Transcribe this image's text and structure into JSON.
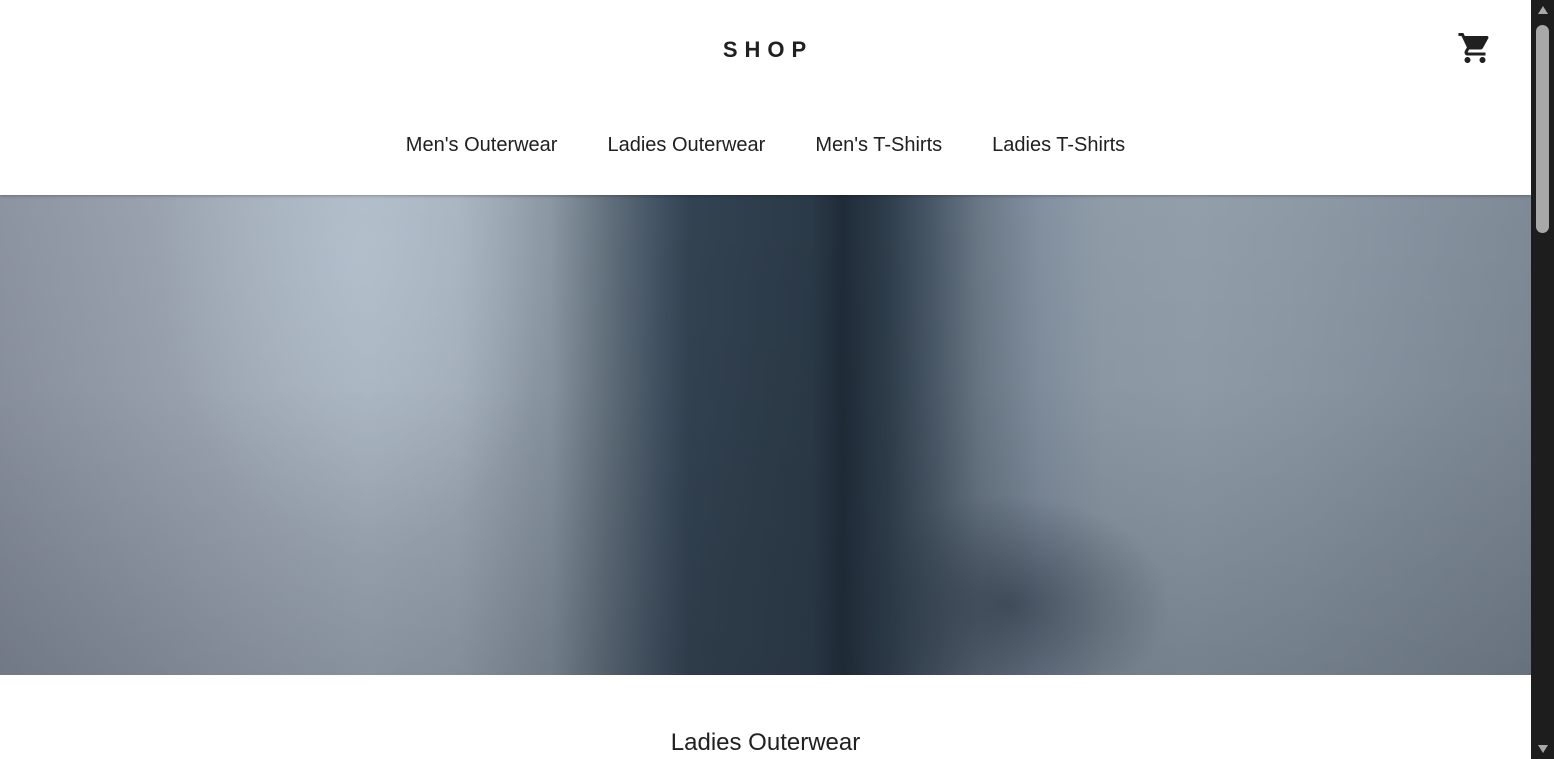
{
  "header": {
    "logo": "SHOP",
    "cart_icon": "shopping-cart-icon"
  },
  "nav": {
    "items": [
      {
        "label": "Men's Outerwear"
      },
      {
        "label": "Ladies Outerwear"
      },
      {
        "label": "Men's T-Shirts"
      },
      {
        "label": "Ladies T-Shirts"
      }
    ]
  },
  "hero": {
    "image": "blurred ladies outerwear banner"
  },
  "section": {
    "title": "Ladies Outerwear"
  },
  "scrollbar": {
    "up_icon": "scroll-up-arrow-icon",
    "down_icon": "scroll-down-arrow-icon"
  },
  "colors": {
    "text": "#202020",
    "background": "#ffffff",
    "scrollbar_track": "#1d1d1d",
    "scrollbar_thumb": "#a8a8a8"
  }
}
